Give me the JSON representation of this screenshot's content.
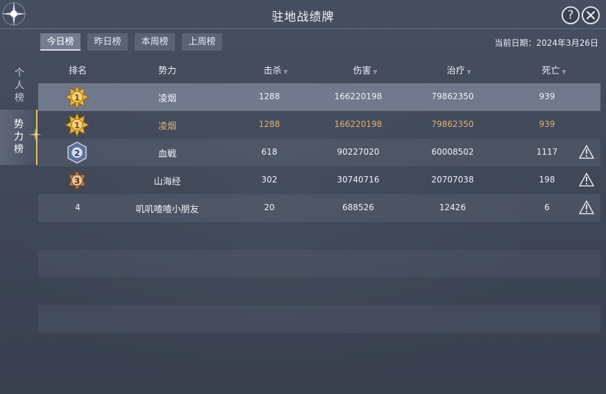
{
  "title": "驻地战绩牌",
  "date_label": "当前日期：2024年3月26日",
  "tabs": [
    {
      "label": "今日榜",
      "active": true
    },
    {
      "label": "昨日榜",
      "active": false
    },
    {
      "label": "本周榜",
      "active": false
    },
    {
      "label": "上周榜",
      "active": false
    }
  ],
  "side_tabs": [
    {
      "label": "个人榜",
      "active": false
    },
    {
      "label": "势力榜",
      "active": true
    }
  ],
  "columns": {
    "rank": "排名",
    "faction": "势力",
    "kills": "击杀",
    "damage": "伤害",
    "healing": "治疗",
    "deaths": "死亡"
  },
  "rows": [
    {
      "rank": "1",
      "medal": "gold",
      "faction": "凌烟",
      "kills": "1288",
      "damage": "166220198",
      "healing": "79862350",
      "deaths": "939",
      "report": false,
      "highlighted": true
    },
    {
      "rank": "1",
      "medal": "gold",
      "faction": "凌烟",
      "kills": "1288",
      "damage": "166220198",
      "healing": "79862350",
      "deaths": "939",
      "report": false,
      "own": true
    },
    {
      "rank": "2",
      "medal": "silver",
      "faction": "血戦",
      "kills": "618",
      "damage": "90227020",
      "healing": "60008502",
      "deaths": "1117",
      "report": true
    },
    {
      "rank": "3",
      "medal": "bronze",
      "faction": "山海经",
      "kills": "302",
      "damage": "30740716",
      "healing": "20707038",
      "deaths": "198",
      "report": true
    },
    {
      "rank": "4",
      "medal": null,
      "faction": "叽叽喳喳小朋友",
      "kills": "20",
      "damage": "688526",
      "healing": "12426",
      "deaths": "6",
      "report": true
    }
  ],
  "colors": {
    "own_row_text": "#e0b072",
    "selected_row_bg": "#96a0b4",
    "gold_medal": "#e8b53a",
    "silver_medal": "#8aa0d0",
    "bronze_medal": "#c08a5a"
  },
  "icons": {
    "help": "question-icon",
    "close": "close-icon",
    "sort": "chevron-down-icon",
    "report": "warning-triangle-icon"
  }
}
